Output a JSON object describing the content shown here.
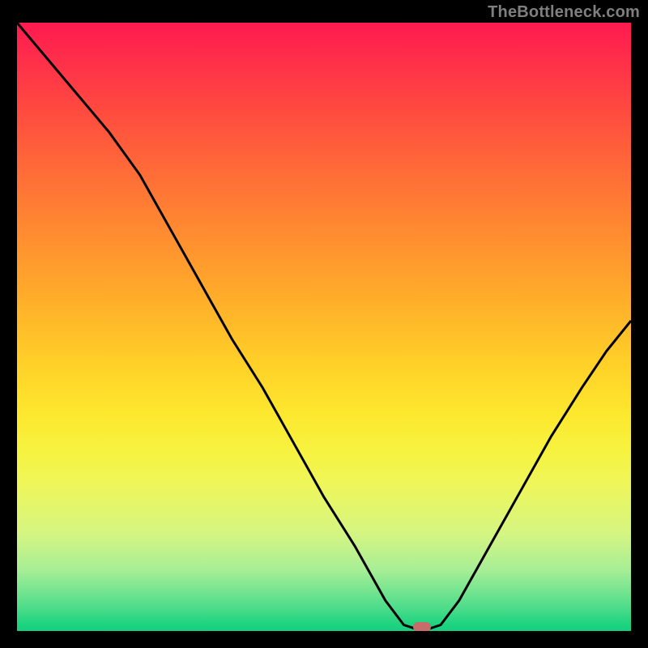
{
  "watermark": "TheBottleneck.com",
  "marker": {
    "x_frac": 0.66,
    "y_frac": 0.994
  },
  "chart_data": {
    "type": "line",
    "title": "",
    "xlabel": "",
    "ylabel": "",
    "xlim": [
      0,
      1
    ],
    "ylim": [
      0,
      1
    ],
    "x": [
      0.0,
      0.05,
      0.1,
      0.15,
      0.2,
      0.25,
      0.3,
      0.35,
      0.4,
      0.45,
      0.5,
      0.55,
      0.6,
      0.63,
      0.66,
      0.69,
      0.72,
      0.77,
      0.82,
      0.87,
      0.92,
      0.96,
      1.0
    ],
    "values": [
      1.0,
      0.94,
      0.88,
      0.82,
      0.75,
      0.66,
      0.57,
      0.48,
      0.4,
      0.31,
      0.22,
      0.14,
      0.05,
      0.01,
      0.0,
      0.01,
      0.05,
      0.14,
      0.23,
      0.32,
      0.4,
      0.46,
      0.51
    ],
    "annotations": [
      {
        "name": "marker",
        "x": 0.66,
        "y": 0.006
      }
    ]
  },
  "colors": {
    "frame": "#000000",
    "watermark": "#7f7f7f",
    "curve": "#000000",
    "marker": "#c76b6b",
    "gradient_stops": [
      "#ff1a4f",
      "#ff4940",
      "#ff8a30",
      "#ffd028",
      "#f7f23e",
      "#a7ee96",
      "#17d07f"
    ]
  }
}
